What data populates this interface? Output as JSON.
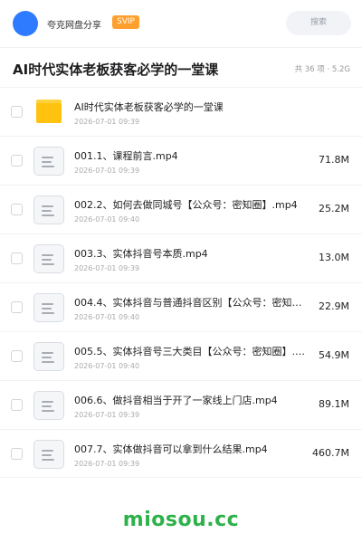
{
  "header": {
    "brand": "夸克网盘分享",
    "badge": "SVIP",
    "search_placeholder": "搜索"
  },
  "page": {
    "title": "AI时代实体老板获客必学的一堂课",
    "meta": "共 36 项 · 5.2G"
  },
  "files": [
    {
      "name": "AI时代实体老板获客必学的一堂课",
      "date": "2026-07-01 09:39",
      "size": "",
      "type": "folder"
    },
    {
      "name": "001.1、课程前言.mp4",
      "date": "2026-07-01 09:39",
      "size": "71.8M",
      "type": "video"
    },
    {
      "name": "002.2、如何去做同城号【公众号：密知圈】.mp4",
      "date": "2026-07-01 09:40",
      "size": "25.2M",
      "type": "video"
    },
    {
      "name": "003.3、实体抖音号本质.mp4",
      "date": "2026-07-01 09:39",
      "size": "13.0M",
      "type": "video"
    },
    {
      "name": "004.4、实体抖音与普通抖音区别【公众号：密知圈】.mp4",
      "date": "2026-07-01 09:40",
      "size": "22.9M",
      "type": "video"
    },
    {
      "name": "005.5、实体抖音号三大类目【公众号：密知圈】.mp4",
      "date": "2026-07-01 09:40",
      "size": "54.9M",
      "type": "video"
    },
    {
      "name": "006.6、做抖音相当于开了一家线上门店.mp4",
      "date": "2026-07-01 09:39",
      "size": "89.1M",
      "type": "video"
    },
    {
      "name": "007.7、实体做抖音可以拿到什么结果.mp4",
      "date": "2026-07-01 09:39",
      "size": "460.7M",
      "type": "video"
    }
  ],
  "footer": {
    "watermark": "miosou.cc"
  },
  "colors": {
    "accent": "#2f7bff",
    "badge": "#ff9f2e",
    "folder": "#ffc20e",
    "watermark": "#2db24a"
  }
}
